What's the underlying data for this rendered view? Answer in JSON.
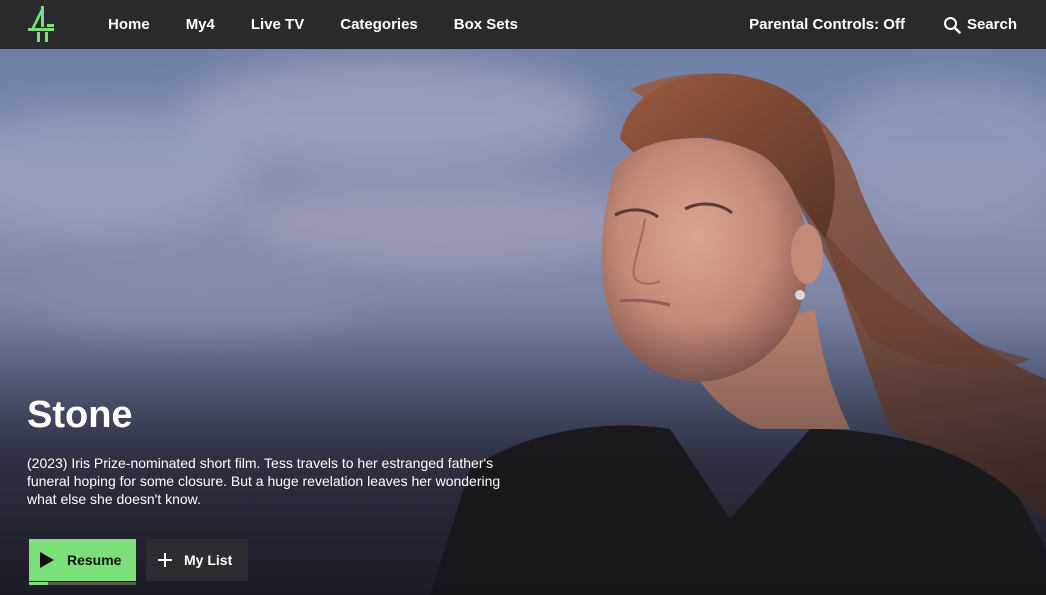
{
  "nav": {
    "logo_alt": "4",
    "links": [
      {
        "label": "Home"
      },
      {
        "label": "My4"
      },
      {
        "label": "Live TV"
      },
      {
        "label": "Categories"
      },
      {
        "label": "Box Sets"
      }
    ],
    "parental_controls": "Parental Controls: Off",
    "search_label": "Search"
  },
  "hero": {
    "title": "Stone",
    "description": "(2023) Iris Prize-nominated short film. Tess travels to her estranged father's funeral hoping for some closure. But a huge revelation leaves her wondering what else she doesn't know.",
    "resume_label": "Resume",
    "resume_progress": 0.18,
    "mylist_label": "My List"
  },
  "colors": {
    "accent": "#7ce07a",
    "navbar_bg": "#2a2a2c"
  },
  "icons": {
    "logo": "channel4-logo",
    "search": "search-icon",
    "play": "play-icon",
    "plus": "plus-icon"
  }
}
